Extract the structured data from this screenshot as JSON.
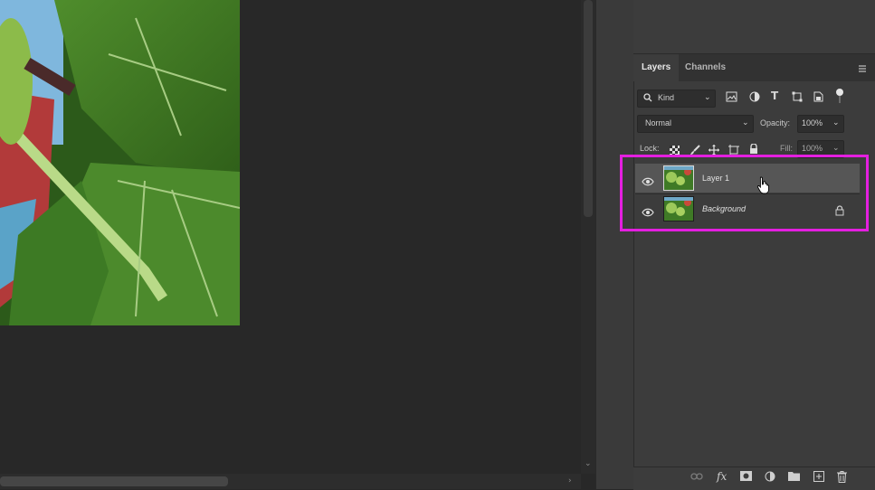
{
  "layers_panel": {
    "tabs": [
      {
        "label": "Layers",
        "active": true
      },
      {
        "label": "Channels",
        "active": false
      }
    ],
    "filter": {
      "label": "Kind"
    },
    "blend_mode": "Normal",
    "opacity": {
      "label": "Opacity:",
      "value": "100%"
    },
    "lock_label": "Lock:",
    "fill": {
      "label": "Fill:",
      "value": "100%"
    },
    "layers": [
      {
        "name": "Layer 1",
        "visible": true,
        "selected": true,
        "locked": false
      },
      {
        "name": "Background",
        "visible": true,
        "selected": false,
        "locked": true
      }
    ]
  },
  "colors": {
    "highlight": "#e41fe0",
    "panel_bg": "#3c3c3c",
    "canvas_bg": "#282828",
    "selected_row": "#5a5a5a"
  }
}
